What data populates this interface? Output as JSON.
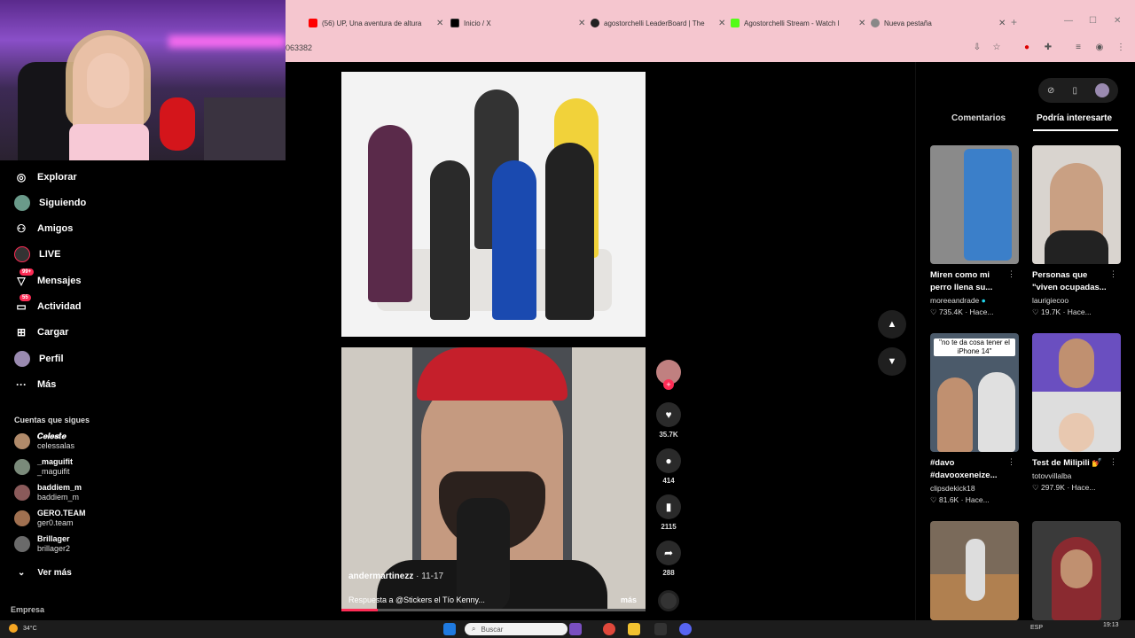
{
  "browser": {
    "tabs": [
      {
        "title": "(56) UP, Una aventura de altura",
        "icon": "youtube-icon",
        "color": "#ff0000"
      },
      {
        "title": "Inicio / X",
        "icon": "x-icon",
        "color": "#000000"
      },
      {
        "title": "agostorchelli LeaderBoard | The",
        "icon": "github-icon",
        "color": "#222222"
      },
      {
        "title": "Agostorchelli Stream - Watch l",
        "icon": "kick-icon",
        "color": "#53fc18"
      },
      {
        "title": "Nueva pestaña",
        "icon": "chrome-icon",
        "color": "#666666"
      }
    ],
    "new_tab": "+",
    "url": "063382"
  },
  "sidebar": {
    "items": [
      {
        "label": "Explorar",
        "icon": "compass-icon"
      },
      {
        "label": "Siguiendo",
        "icon": "following-avatar-icon"
      },
      {
        "label": "Amigos",
        "icon": "people-icon"
      },
      {
        "label": "LIVE",
        "icon": "live-icon"
      },
      {
        "label": "Mensajes",
        "icon": "message-icon",
        "badge": "99+"
      },
      {
        "label": "Actividad",
        "icon": "activity-icon",
        "badge": "55"
      },
      {
        "label": "Cargar",
        "icon": "upload-icon"
      },
      {
        "label": "Perfil",
        "icon": "profile-avatar-icon"
      },
      {
        "label": "Más",
        "icon": "more-icon"
      }
    ],
    "following_title": "Cuentas que sigues",
    "following": [
      {
        "name": "𝑪𝒆𝒍𝒆𝒔𝒕𝒆",
        "handle": "celessalas",
        "verified": true
      },
      {
        "name": "_maguifit",
        "handle": "_maguifit"
      },
      {
        "name": "baddiem_m",
        "handle": "baddiem_m"
      },
      {
        "name": "GERO.TEAM",
        "handle": "ger0.team"
      },
      {
        "name": "Brillager",
        "handle": "brillager2"
      }
    ],
    "see_more": "Ver más",
    "footer": "Empresa"
  },
  "video": {
    "creator": "andermartinezz",
    "date": "· 11-17",
    "description": "Respuesta a @Stickers el Tío Kenny...",
    "more": "más",
    "progress": 0.12,
    "likes": "35.7K",
    "comments": "414",
    "saves": "2115",
    "shares": "288"
  },
  "right_panel": {
    "tabs": [
      "Comentarios",
      "Podría interesarte"
    ],
    "active_tab": "Podría interesarte",
    "cards": [
      {
        "title1": "Miren como mi",
        "title2": "perro llena su...",
        "user": "moreeandrade",
        "verified": true,
        "likes": "735.4K",
        "time": "Hace...",
        "thumb_color": "#3b7fc9"
      },
      {
        "title1": "Personas que",
        "title2": "\"viven ocupadas...",
        "user": "laurigiecoo",
        "likes": "19.7K",
        "time": "Hace...",
        "thumb_color": "#c9a083"
      },
      {
        "title1": "#davo",
        "title2": "#davooxeneize...",
        "user": "clipsdekick18",
        "likes": "81.6K",
        "time": "Hace...",
        "thumb_color": "#4b5a6a",
        "overlay": "\"no te da cosa tener el iPhone 14\""
      },
      {
        "title1": "Test de Milipili 💅",
        "title2": "",
        "user": "totovvillalba",
        "likes": "297.9K",
        "time": "Hace...",
        "thumb_color": "#6a4fc0"
      },
      {
        "title1": "",
        "title2": "",
        "user": "",
        "likes": "",
        "time": "",
        "thumb_color": "#7a6a5a"
      },
      {
        "title1": "",
        "title2": "",
        "user": "",
        "likes": "",
        "time": "",
        "thumb_color": "#8a2a30"
      }
    ]
  },
  "taskbar": {
    "weather": "34°C",
    "search_placeholder": "Buscar",
    "lang": "ESP",
    "time": "19:13"
  }
}
